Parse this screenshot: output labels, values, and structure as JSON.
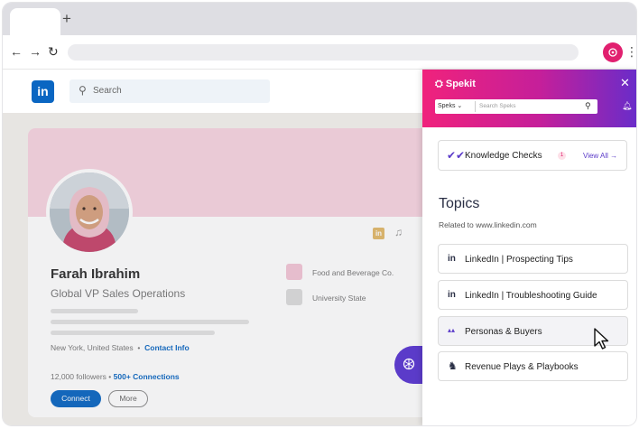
{
  "browser": {
    "new_tab_symbol": "+",
    "back_icon": "←",
    "forward_icon": "→",
    "reload_icon": "↻",
    "menu_icon": "⋮"
  },
  "linkedin": {
    "logo_text": "in",
    "search_placeholder": "Search",
    "profile": {
      "name": "Farah Ibrahim",
      "headline": "Global VP Sales Operations",
      "location": "New York, United States",
      "contact_info": "Contact Info",
      "followers": "12,000 followers",
      "separator": "•",
      "connections": "500+ Connections",
      "connect_label": "Connect",
      "more_label": "More"
    },
    "experience": [
      {
        "label": "Food and Beverage Co.",
        "color": "#f3c6d6"
      },
      {
        "label": "University State",
        "color": "#dcdcdc"
      }
    ]
  },
  "spekit": {
    "brand": "Spekit",
    "close_icon": "✕",
    "search_scope": "Speks",
    "search_placeholder": "Search Speks",
    "knowledge_checks": {
      "label": "Knowledge Checks",
      "badge": "1",
      "view_all": "View All →"
    },
    "topics_heading": "Topics",
    "related_to": "Related to www.linkedin.com",
    "topics": [
      {
        "icon": "linkedin-icon",
        "glyph": "in",
        "label": "LinkedIn | Prospecting Tips"
      },
      {
        "icon": "linkedin-icon",
        "glyph": "in",
        "label": "LinkedIn | Troubleshooting Guide"
      },
      {
        "icon": "people-icon",
        "glyph": "▴▴",
        "label": "Personas & Buyers"
      },
      {
        "icon": "chess-knight-icon",
        "glyph": "♞",
        "label": "Revenue Plays & Playbooks"
      }
    ]
  },
  "colors": {
    "spekit_pink": "#f0227c",
    "spekit_purple": "#6a2cc9",
    "linkedin_blue": "#0a66c2"
  }
}
